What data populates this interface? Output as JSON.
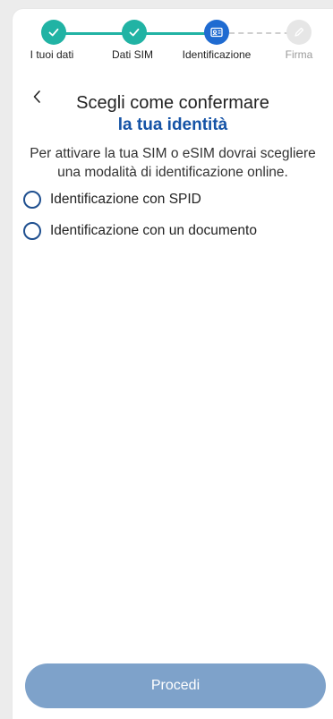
{
  "stepper": {
    "steps": [
      {
        "label": "I tuoi dati",
        "state": "done"
      },
      {
        "label": "Dati SIM",
        "state": "done"
      },
      {
        "label": "Identificazione",
        "state": "active"
      },
      {
        "label": "Firma",
        "state": "todo"
      }
    ],
    "icons": [
      "check-icon",
      "check-icon",
      "id-card-icon",
      "pen-icon"
    ]
  },
  "header": {
    "title_line1": "Scegli come confermare",
    "title_line2": "la tua identità"
  },
  "description": "Per attivare la tua SIM o eSIM dovrai scegliere una modalità di identificazione online.",
  "options": [
    {
      "label": "Identificazione con SPID",
      "selected": false
    },
    {
      "label": "Identificazione con un documento",
      "selected": false
    }
  ],
  "actions": {
    "proceed_label": "Procedi"
  },
  "colors": {
    "done": "#21b3a4",
    "active": "#1f6bd1",
    "title_accent": "#1553a6",
    "button_disabled": "#7ea2ca"
  }
}
